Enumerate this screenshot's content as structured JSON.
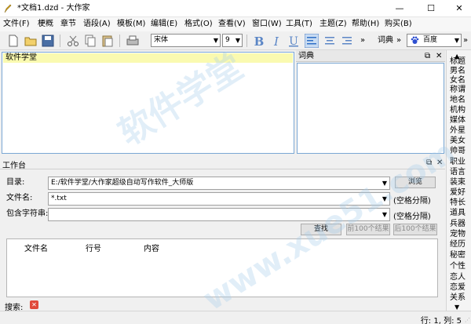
{
  "window": {
    "title": "*文档1.dzd - 大作家"
  },
  "menus": [
    "文件(F)",
    "梗概",
    "章节",
    "语段(A)",
    "模板(M)",
    "编辑(E)",
    "格式(O)",
    "查看(V)",
    "窗口(W)",
    "工具(T)",
    "主题(Z)",
    "帮助(H)",
    "购买(B)"
  ],
  "toolbar": {
    "font": "宋体",
    "size": "9",
    "dict_label": "词典",
    "search_engine": "百度",
    "overflow": "»"
  },
  "editor": {
    "text": "软件学堂"
  },
  "dict_panel": {
    "title": "词典"
  },
  "categories": [
    "标题",
    "男名",
    "女名",
    "称谓",
    "地名",
    "机构",
    "媒体",
    "外星",
    "美女",
    "帅哥",
    "职业",
    "语言",
    "装束",
    "爱好",
    "特长",
    "道具",
    "兵器",
    "宠物",
    "经历",
    "秘密",
    "个性",
    "恋人",
    "恋爱",
    "关系"
  ],
  "workbench": {
    "title": "工作台",
    "dir_label": "目录:",
    "dir_value": "E:/软件学堂/大作家超级自动写作软件_大师版",
    "browse": "浏览",
    "filename_label": "文件名:",
    "filename_value": "*.txt",
    "hint": "(空格分隔)",
    "contains_label": "包含字符串:",
    "contains_value": "",
    "search": "查找",
    "prev": "前100个结果",
    "next": "后100个结果",
    "columns": [
      "文件名",
      "行号",
      "内容"
    ],
    "tab": "搜索:"
  },
  "status": {
    "position": "行: 1, 列: 5"
  },
  "watermark": {
    "cn": "软件学堂",
    "url": "www.xue51.com"
  },
  "colors": {
    "accent": "#2e6fc7",
    "highlight": "#fafab0",
    "close": "#e04a3a"
  }
}
